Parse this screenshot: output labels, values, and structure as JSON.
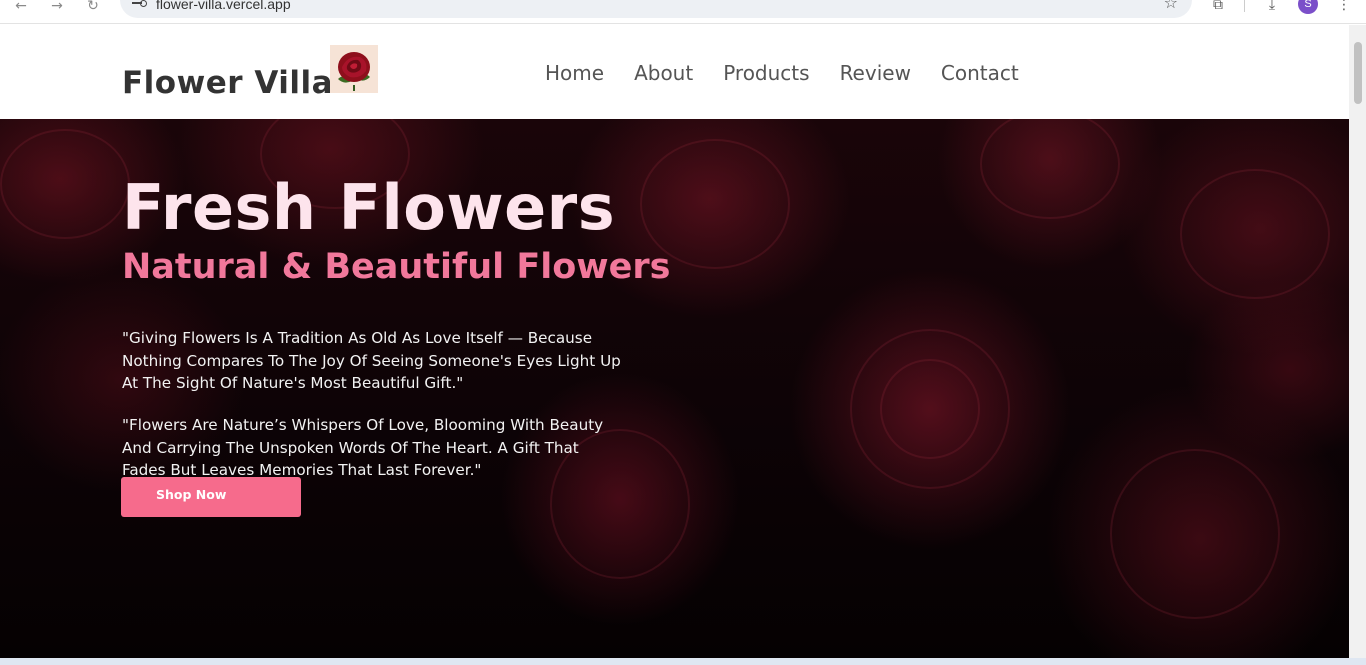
{
  "browser": {
    "url": "flower-villa.vercel.app",
    "profile_initial": "S"
  },
  "header": {
    "logo_text": "Flower Villa",
    "nav": [
      "Home",
      "About",
      "Products",
      "Review",
      "Contact"
    ]
  },
  "hero": {
    "title": "Fresh Flowers",
    "subtitle": "Natural & Beautiful Flowers",
    "quote1": "\"Giving Flowers Is A Tradition As Old As Love Itself — Because Nothing Compares To The Joy Of Seeing Someone's Eyes Light Up At The Sight Of Nature's Most Beautiful Gift.\"",
    "quote2": "\"Flowers Are Nature’s Whispers Of Love, Blooming With Beauty And Carrying The Unspoken Words Of The Heart. A Gift That Fades But Leaves Memories That Last Forever.\"",
    "cta_label": "Shop Now"
  },
  "colors": {
    "accent": "#f66b8c",
    "subtitle": "#f1789b",
    "title": "#fde4ec"
  },
  "icons": [
    "back-icon",
    "forward-icon",
    "reload-icon",
    "site-info-icon",
    "bookmark-star-icon",
    "extensions-icon",
    "download-icon",
    "menu-dots-icon",
    "rose-logo-icon"
  ]
}
